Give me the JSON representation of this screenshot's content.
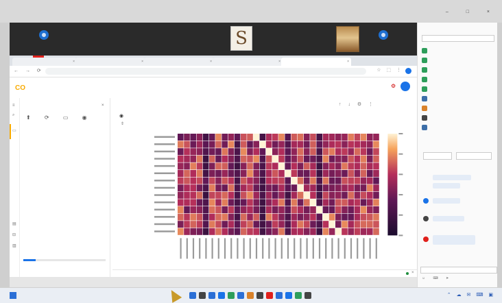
{
  "colors": {
    "call_bg": "#2a2a2a",
    "accent_blue": "#1a73e8",
    "colab_orange": "#f9ab00",
    "tab_red": "#e0201b",
    "heat_low": "#1b0c2e",
    "heat_mid": "#b42d5a",
    "heat_high": "#f6a35c",
    "heat_top": "#fff3d6"
  },
  "window": {
    "app_title": "",
    "controls": "–  □  ×"
  },
  "call": {
    "participants": [
      {
        "name": "",
        "sub": "",
        "kind": "dot"
      },
      {
        "name": "",
        "sub": "",
        "kind": "name"
      },
      {
        "name": "",
        "sub": "",
        "kind": "name"
      },
      {
        "name": "",
        "sub": "",
        "kind": "name"
      },
      {
        "name": "",
        "sub": "",
        "kind": "logo",
        "logo_text": "S"
      },
      {
        "name": "",
        "sub": "",
        "kind": "name"
      },
      {
        "name": "",
        "sub": "",
        "kind": "portrait"
      },
      {
        "name": "",
        "sub": "",
        "kind": "dot"
      }
    ],
    "mic_label": "",
    "cam_label": "",
    "leave_label": ""
  },
  "browser": {
    "tabs": [
      {
        "title": "",
        "active": false
      },
      {
        "title": "",
        "active": false
      },
      {
        "title": "",
        "active": false
      },
      {
        "title": "",
        "active": false
      },
      {
        "title": "",
        "active": true
      }
    ],
    "nav_glyphs": "←  →  ⟳",
    "url": "",
    "ext_glyphs": "☆  ⬚  ⋮"
  },
  "colab": {
    "logo": "CO",
    "notebook_title": "",
    "menu": [],
    "comment_label": "",
    "share_label": "",
    "status_text": ""
  },
  "files": {
    "title": "",
    "close_glyph": "×",
    "toolbar_glyphs": "⬆ ⟳ ▭ ◉",
    "tree": [],
    "disk_label": "",
    "disk_fraction": 0.15
  },
  "output": {
    "toolbar": "",
    "cell_tools": "↑ ↓ ⚙ ⋮",
    "ram_label": "",
    "run_glyph": "◉",
    "expand_glyph": "⇕",
    "heatmap": {
      "rows": 14,
      "cols": 32
    }
  },
  "chat": {
    "title": "",
    "contacts": [
      {
        "name": "",
        "status": "",
        "color": "#2e9e5b"
      },
      {
        "name": "",
        "status": "",
        "color": "#2e9e5b"
      },
      {
        "name": "",
        "status": "",
        "color": "#2e9e5b"
      },
      {
        "name": "",
        "status": "",
        "color": "#2e9e5b"
      },
      {
        "name": "",
        "status": "",
        "color": "#2e9e5b"
      },
      {
        "name": "",
        "status": "",
        "color": "#3d6ea8"
      },
      {
        "name": "",
        "status": "",
        "color": "#d9822b"
      },
      {
        "name": "",
        "status": "",
        "color": "#444444"
      },
      {
        "name": "",
        "status": "",
        "color": "#3d6ea8"
      }
    ],
    "tabs": [
      "",
      ""
    ],
    "heading": "",
    "messages": [],
    "input_placeholder": "",
    "action_glyphs": "☺ ⌨ ➤"
  },
  "taskbar": {
    "apps": [
      "#2b6fd6",
      "#444444",
      "#2b6fd6",
      "#1a73e8",
      "#2e9e5b",
      "#2b6fd6",
      "#d9822b",
      "#444444",
      "#e0201b",
      "#2b6fd6",
      "#1a73e8",
      "#2e9e5b",
      "#444444"
    ],
    "tray": "⌃ ☁ ✉ ⌨ ▣"
  }
}
